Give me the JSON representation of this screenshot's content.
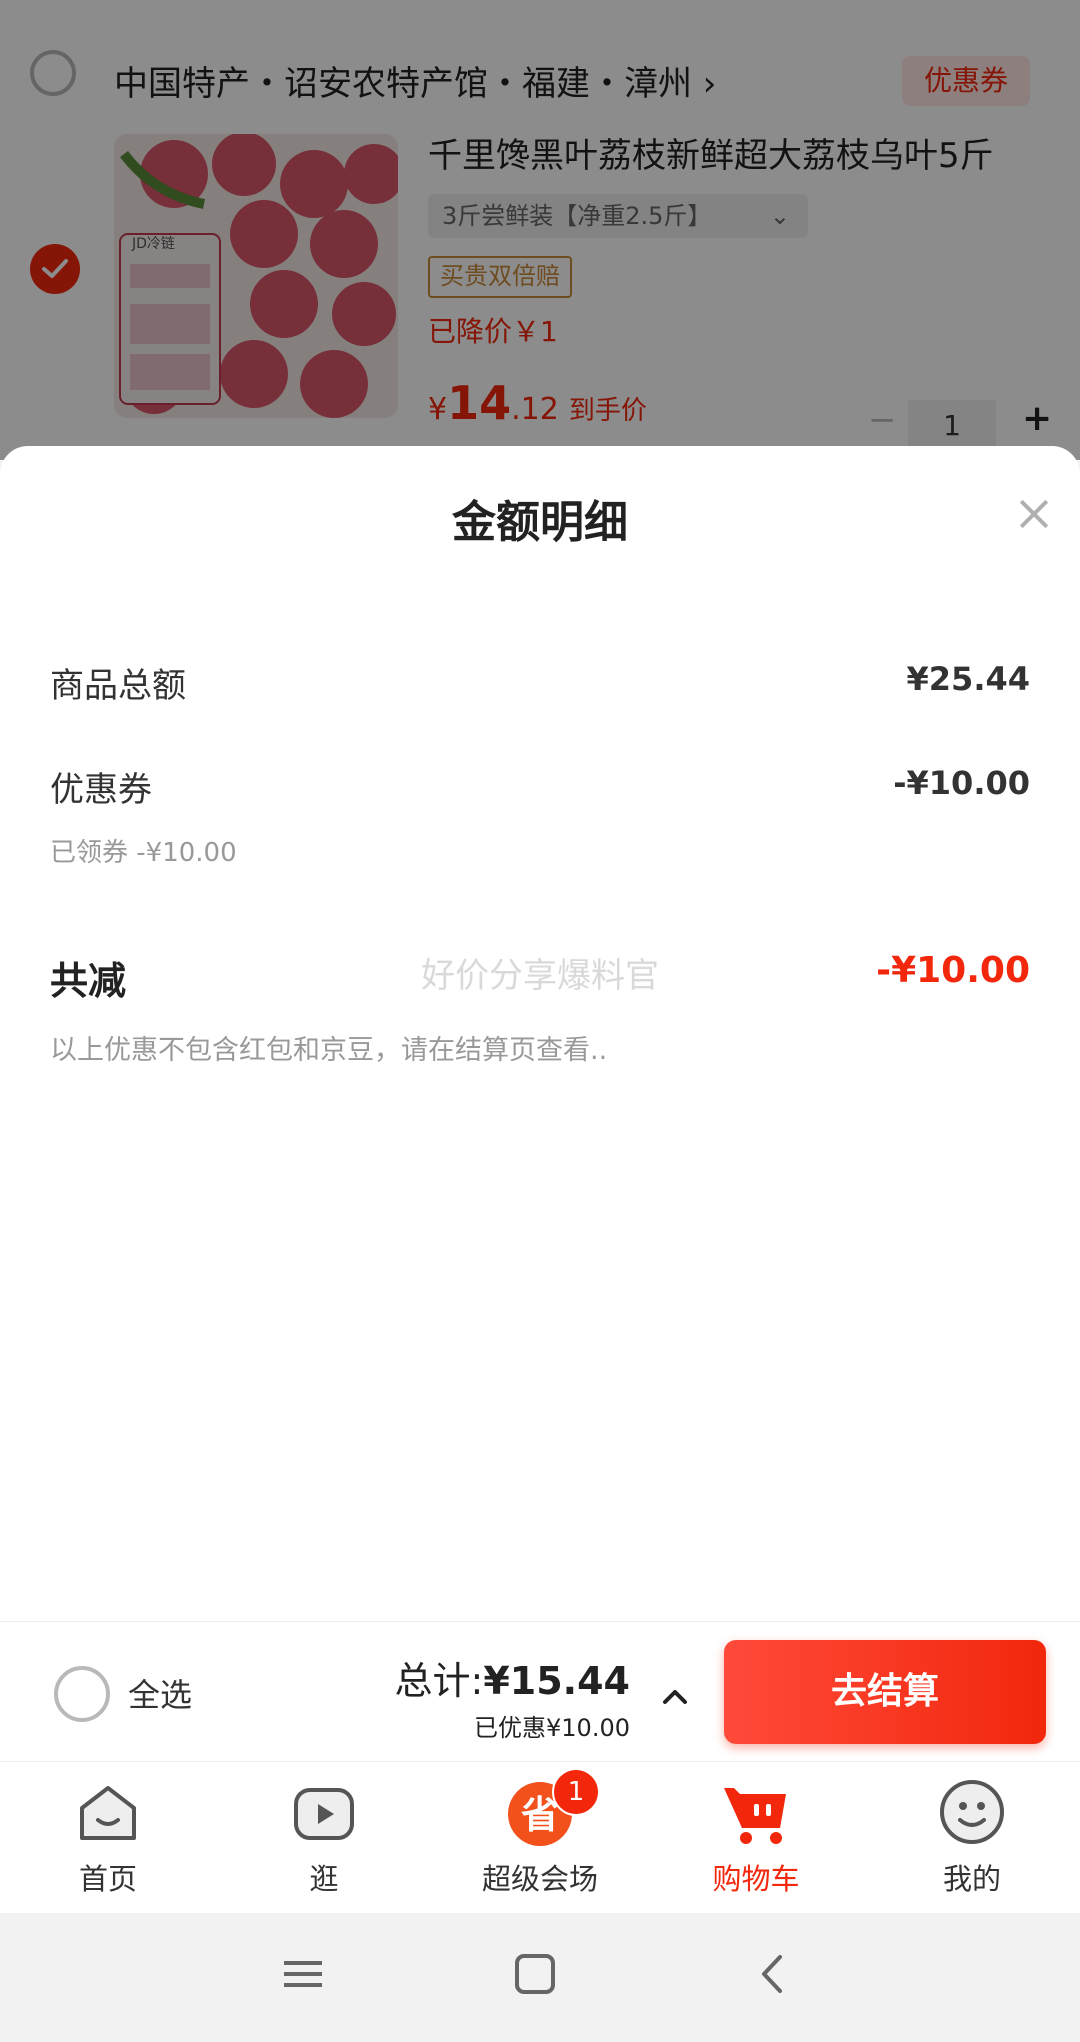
{
  "background_cart": {
    "shop_title": "中国特产・诏安农特产馆・福建・漳州 ›",
    "coupon_tag": "优惠券",
    "product": {
      "name": "千里馋黑叶荔枝新鲜超大荔枝乌叶5斤",
      "spec": "3斤尝鲜装【净重2.5斤】",
      "guarantee": "买贵双倍赔",
      "price_drop": "已降价￥1",
      "price_yen": "¥",
      "price_int": "14",
      "price_dec": ".12",
      "price_label": "到手价",
      "quantity": "1",
      "image_text": "JD冷链"
    }
  },
  "sheet": {
    "title": "金额明细",
    "rows": [
      {
        "label": "商品总额",
        "value": "¥25.44"
      },
      {
        "label": "优惠券",
        "value": "-¥10.00",
        "sub": "已领券 -¥10.00"
      }
    ],
    "total_label": "共减",
    "total_value": "-¥10.00",
    "watermark": "好价分享爆料官",
    "note": "以上优惠不包含红包和京豆，请在结算页查看.."
  },
  "bottom_bar": {
    "select_all": "全选",
    "total_prefix": "总计:",
    "total_value": "¥15.44",
    "saved": "已优惠¥10.00",
    "checkout": "去结算"
  },
  "tabs": [
    {
      "label": "首页",
      "icon": "home-icon"
    },
    {
      "label": "逛",
      "icon": "play-icon"
    },
    {
      "label": "超级会场",
      "icon": "super-venue-icon",
      "badge": "1"
    },
    {
      "label": "购物车",
      "icon": "cart-icon",
      "active": true
    },
    {
      "label": "我的",
      "icon": "smile-icon"
    }
  ],
  "colors": {
    "accent": "#f2270c",
    "overlay": "rgba(0,0,0,0.45)"
  }
}
